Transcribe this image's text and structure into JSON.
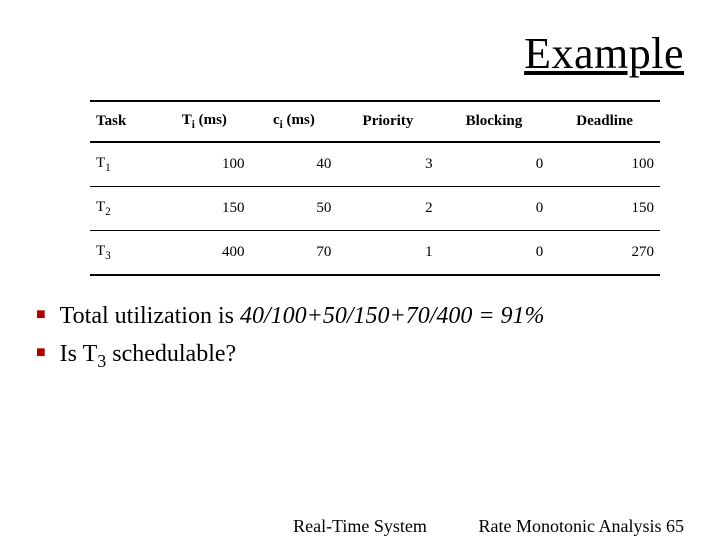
{
  "title": "Example",
  "table": {
    "headers": {
      "task": "Task",
      "Ti_pre": "T",
      "Ti_sub": "i",
      "Ti_post": " (ms)",
      "ci_pre": "c",
      "ci_sub": "i",
      "ci_post": " (ms)",
      "priority": "Priority",
      "blocking": "Blocking",
      "deadline": "Deadline"
    },
    "rows": [
      {
        "task_pre": "T",
        "task_sub": "1",
        "Ti": "100",
        "ci": "40",
        "priority": "3",
        "blocking": "0",
        "deadline": "100"
      },
      {
        "task_pre": "T",
        "task_sub": "2",
        "Ti": "150",
        "ci": "50",
        "priority": "2",
        "blocking": "0",
        "deadline": "150"
      },
      {
        "task_pre": "T",
        "task_sub": "3",
        "Ti": "400",
        "ci": "70",
        "priority": "1",
        "blocking": "0",
        "deadline": "270"
      }
    ]
  },
  "bullets": {
    "b1_lead": "Total utilization is ",
    "b1_expr": "40/100+50/150+70/400 = 91%",
    "b2_lead": "Is T",
    "b2_sub": "3",
    "b2_tail": " schedulable?"
  },
  "footer": {
    "center": "Real-Time System",
    "right_label": "Rate Monotonic Analysis ",
    "right_num": "65"
  },
  "chart_data": {
    "type": "table",
    "columns": [
      "Task",
      "Ti (ms)",
      "ci (ms)",
      "Priority",
      "Blocking",
      "Deadline"
    ],
    "rows": [
      [
        "T1",
        100,
        40,
        3,
        0,
        100
      ],
      [
        "T2",
        150,
        50,
        2,
        0,
        150
      ],
      [
        "T3",
        400,
        70,
        1,
        0,
        270
      ]
    ],
    "title": "Example"
  }
}
